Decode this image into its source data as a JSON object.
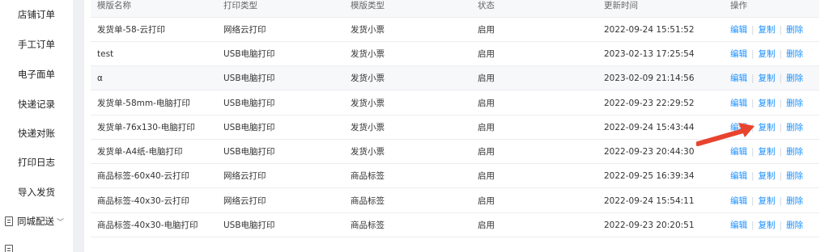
{
  "sidebar": {
    "items": [
      {
        "label": "店铺订单"
      },
      {
        "label": "手工订单"
      },
      {
        "label": "电子面单"
      },
      {
        "label": "快递记录"
      },
      {
        "label": "快递对账"
      },
      {
        "label": "打印日志"
      },
      {
        "label": "导入发货"
      }
    ],
    "group": {
      "label": "同城配送",
      "icon": "document-icon",
      "chevron": "chevron-down-icon"
    }
  },
  "table": {
    "headers": [
      "模版名称",
      "打印类型",
      "模版类型",
      "状态",
      "更新时间",
      "操作"
    ],
    "actions": {
      "edit": "编辑",
      "copy": "复制",
      "delete": "删除",
      "separator": "|"
    },
    "rows": [
      {
        "name": "发货单-58-云打印",
        "print_type": "网络云打印",
        "template_type": "发货小票",
        "status": "启用",
        "updated": "2022-09-24 15:51:52"
      },
      {
        "name": "test",
        "print_type": "USB电脑打印",
        "template_type": "发货小票",
        "status": "启用",
        "updated": "2023-02-13 17:25:54"
      },
      {
        "name": "α",
        "print_type": "USB电脑打印",
        "template_type": "发货小票",
        "status": "启用",
        "updated": "2023-02-09 21:14:56"
      },
      {
        "name": "发货单-58mm-电脑打印",
        "print_type": "USB电脑打印",
        "template_type": "发货小票",
        "status": "启用",
        "updated": "2022-09-23 22:29:52"
      },
      {
        "name": "发货单-76x130-电脑打印",
        "print_type": "USB电脑打印",
        "template_type": "发货小票",
        "status": "启用",
        "updated": "2022-09-24 15:43:44"
      },
      {
        "name": "发货单-A4纸-电脑打印",
        "print_type": "USB电脑打印",
        "template_type": "发货小票",
        "status": "启用",
        "updated": "2022-09-23 20:44:30"
      },
      {
        "name": "商品标签-60x40-云打印",
        "print_type": "网络云打印",
        "template_type": "商品标签",
        "status": "启用",
        "updated": "2022-09-25 16:39:34"
      },
      {
        "name": "商品标签-40x30-云打印",
        "print_type": "网络云打印",
        "template_type": "商品标签",
        "status": "启用",
        "updated": "2022-09-24 15:54:11"
      },
      {
        "name": "商品标签-40x30-电脑打印",
        "print_type": "USB电脑打印",
        "template_type": "商品标签",
        "status": "启用",
        "updated": "2022-09-23 20:20:51"
      }
    ]
  },
  "annotation": {
    "arrow_color": "#e8432e",
    "points_to": "复制"
  },
  "colors": {
    "link": "#1a90ff",
    "header_bg": "#f7f8fa",
    "divider_bg": "#eef0f3"
  }
}
